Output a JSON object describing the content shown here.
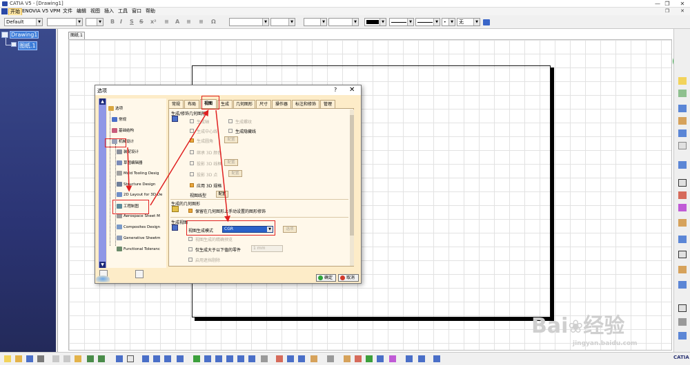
{
  "window": {
    "title": "CATIA V5 - [Drawing1]",
    "controls": [
      "—",
      "❐",
      "✕"
    ]
  },
  "menubar": {
    "items": [
      "开始",
      "ENOVIA V5 VPM",
      "文件",
      "编辑",
      "视图",
      "插入",
      "工具",
      "窗口",
      "帮助"
    ]
  },
  "toolbar": {
    "style_combo": "Default",
    "bold": "B",
    "italic": "I",
    "underline": "S",
    "strike": "S",
    "fill_combo": "无"
  },
  "tree": {
    "root": "Drawing1",
    "child": "图纸.1"
  },
  "sheet_tab": "图纸.1",
  "dialog": {
    "title": "选项",
    "help": "?",
    "close": "✕",
    "tree_items": [
      "选项",
      "常规",
      "基础结构",
      "机械设计",
      "装配设计",
      "草图编辑器",
      "Mold Tooling Desig",
      "Structure Design",
      "2D Layout for 3D De",
      "工程制图",
      "Aerospace Sheet M",
      "Composites Design",
      "Generative Sheetm",
      "Functional Toleranc"
    ],
    "tabs": [
      "常规",
      "布局",
      "视图",
      "生成",
      "几何图形",
      "尺寸",
      "操作器",
      "标注和修饰",
      "管理"
    ],
    "active_tab": "视图",
    "section_geometry": "生成/修饰几何图形",
    "options_geometry": [
      {
        "label": "生成轴",
        "checked": false,
        "enabled": false
      },
      {
        "label": "生成螺纹",
        "checked": false,
        "enabled": false
      },
      {
        "label": "生成中心线",
        "checked": false,
        "enabled": false
      },
      {
        "label": "生成隐藏线",
        "checked": false,
        "enabled": true
      },
      {
        "label": "生成圆角",
        "checked": true,
        "enabled": false
      },
      {
        "label": "继承 3D 颜色",
        "checked": false,
        "enabled": false
      },
      {
        "label": "投影 3D 线框",
        "checked": false,
        "enabled": false
      },
      {
        "label": "投影 3D 点",
        "checked": false,
        "enabled": false
      },
      {
        "label": "应用 3D 规格",
        "checked": true,
        "enabled": true
      }
    ],
    "config_button": "配置",
    "view_linetype_label": "视图线型",
    "view_linetype_button": "配置",
    "section_generated_geometry": "生成的几何图形",
    "keep_modified_geometry": "保留在几何图形上手动设置的图形修饰",
    "section_generate_view": "生成视图",
    "view_generation_mode_label": "视图生成模式",
    "view_generation_mode_value": "CGR",
    "view_generation_mode_button": "选项",
    "exact_preview": "视图生成的精确预览",
    "only_larger_parts": "仅生成大于以下值的零件",
    "size_value": "1 mm",
    "occlusion_culling": "启用遮挡剔除",
    "ok_label": "确定",
    "cancel_label": "取消"
  },
  "watermark": {
    "brand": "Bai",
    "brand_cn": "经验",
    "url": "jingyan.baidu.com"
  },
  "colors": {
    "accent_orange": "#e8a63c",
    "highlight_blue": "#2a62c8",
    "annotation_red": "#e02020"
  }
}
